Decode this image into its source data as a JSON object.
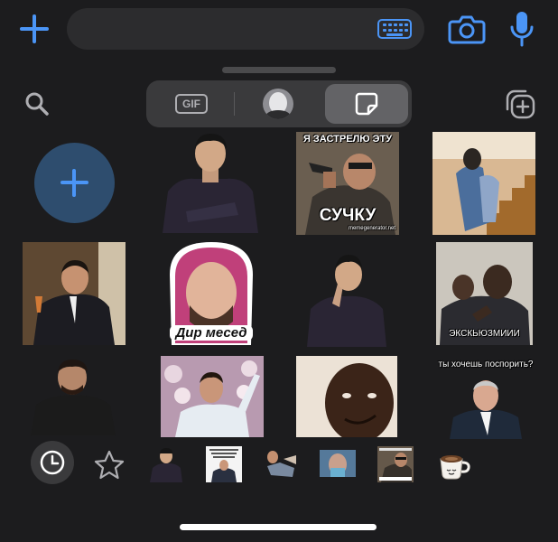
{
  "input_bar": {
    "icons": {
      "attach": "plus-icon",
      "keyboard": "keyboard-icon",
      "camera": "camera-icon",
      "mic": "microphone-icon"
    },
    "message_placeholder": ""
  },
  "picker": {
    "segments": [
      {
        "id": "gif",
        "label": "GIF"
      },
      {
        "id": "avatar",
        "icon": "memoji-avatar-icon"
      },
      {
        "id": "stickers",
        "icon": "sticker-icon",
        "selected": true
      }
    ],
    "search_icon": "search-icon",
    "add_pack_icon": "add-sticker-pack-icon",
    "add_sticker_icon": "plus-icon"
  },
  "stickers": [
    {
      "id": "s1",
      "caption": ""
    },
    {
      "id": "s2",
      "caption_top": "Я ЗАСТРЕЛЮ ЭТУ",
      "caption_bottom": "СУЧКУ",
      "watermark": "memegenerator.net"
    },
    {
      "id": "s3",
      "caption": ""
    },
    {
      "id": "s4",
      "caption": ""
    },
    {
      "id": "s5",
      "caption": "Дир месед"
    },
    {
      "id": "s6",
      "caption": ""
    },
    {
      "id": "s7",
      "caption": "ЭКСКЬЮЗМИИИ"
    },
    {
      "id": "s8",
      "caption": ""
    },
    {
      "id": "s9",
      "caption": ""
    },
    {
      "id": "s10",
      "caption": ""
    },
    {
      "id": "s11",
      "caption": "ты хочешь поспорить?"
    }
  ],
  "bottom_tabs": {
    "recent_icon": "clock-icon",
    "favorites_icon": "star-icon",
    "packs": [
      "pack-1",
      "pack-2",
      "pack-3",
      "pack-4",
      "pack-5",
      "pack-6-coffee"
    ]
  },
  "colors": {
    "accent": "#4b95f6",
    "background": "#1c1c1e",
    "field": "#2c2c2e"
  }
}
